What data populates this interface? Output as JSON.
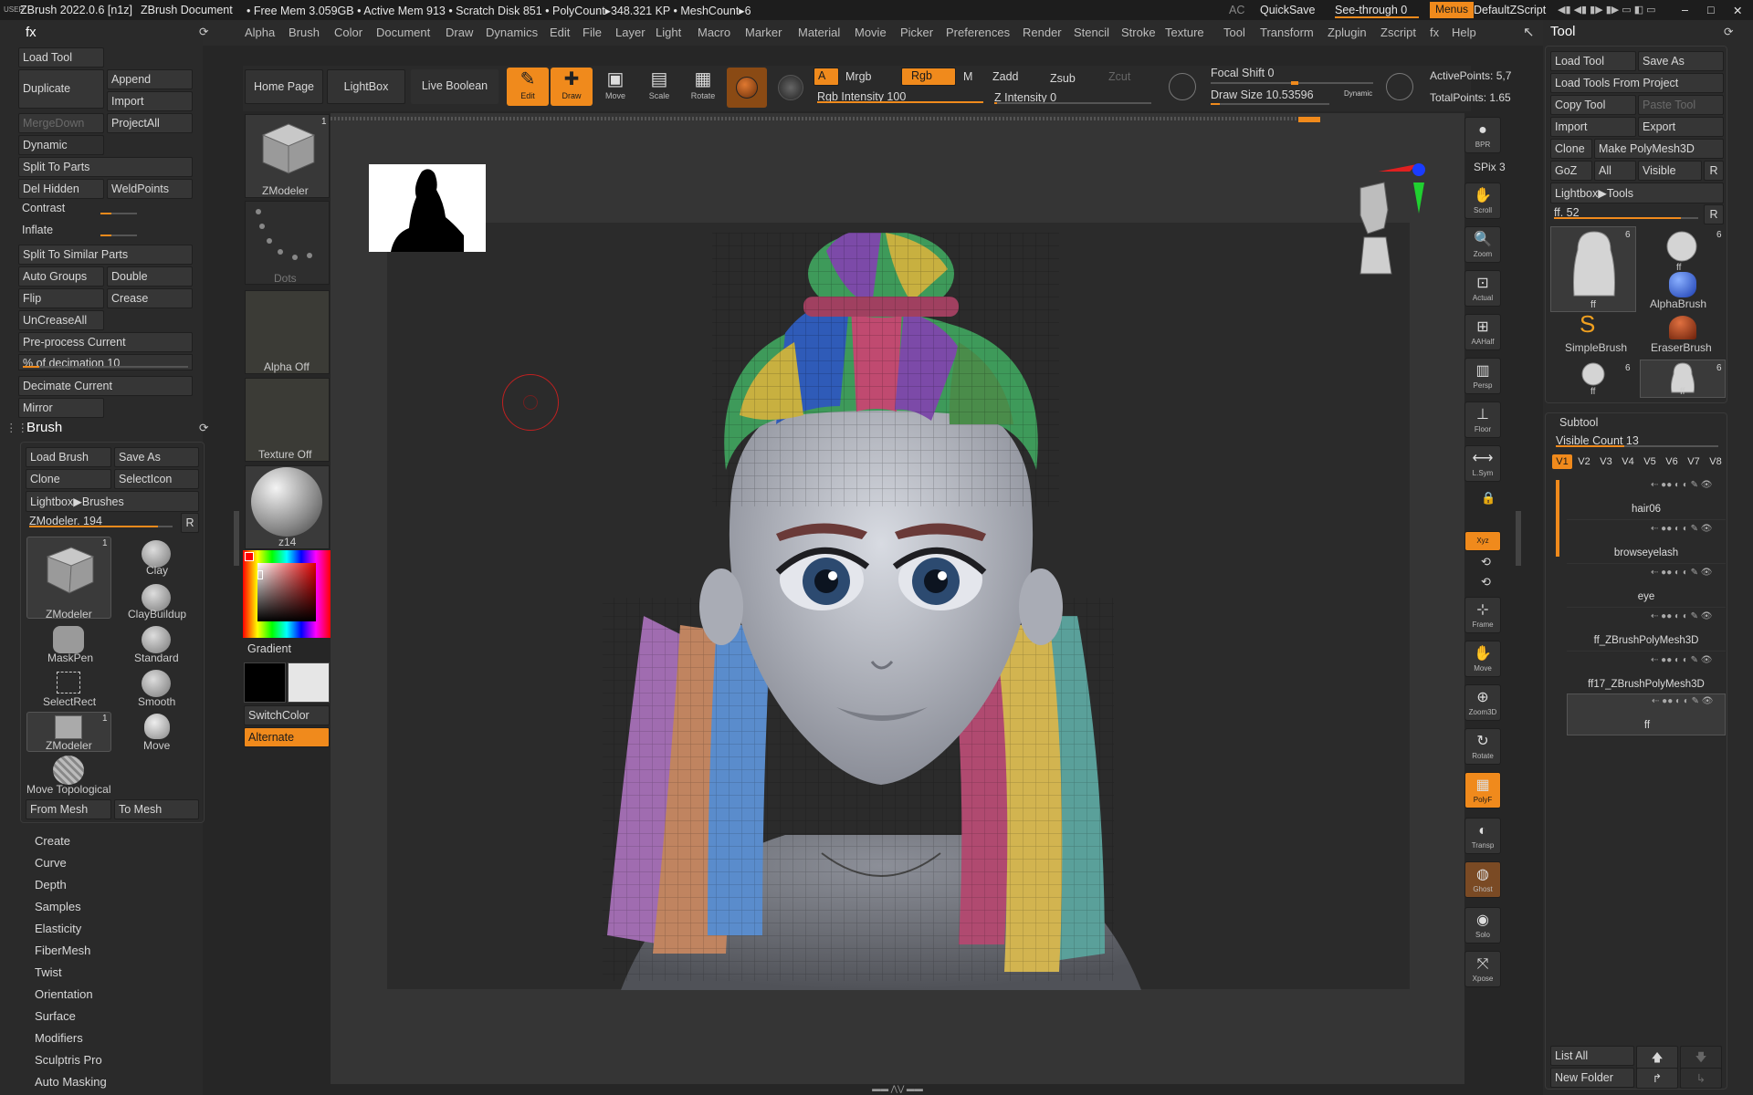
{
  "titlebar": {
    "app": "ZBrush 2022.0.6 [n1z]",
    "doc": "ZBrush Document",
    "stats": "• Free Mem 3.059GB • Active Mem 913 • Scratch Disk 851 • PolyCount▸348.321 KP • MeshCount▸6",
    "ac": "AC",
    "quicksave": "QuickSave",
    "seethrough": "See-through  0",
    "menus": "Menus",
    "script": "DefaultZScript",
    "min": "–",
    "max": "□",
    "close": "✕"
  },
  "menubar": [
    "Alpha",
    "Brush",
    "Color",
    "Document",
    "Draw",
    "Dynamics",
    "Edit",
    "File",
    "Layer",
    "Light",
    "Macro",
    "Marker",
    "Material",
    "Movie",
    "Picker",
    "Preferences",
    "Render",
    "Stencil",
    "Stroke",
    "Texture",
    "Tool",
    "Transform",
    "Zplugin",
    "Zscript",
    "fx",
    "Help"
  ],
  "toolbar": {
    "home": "Home Page",
    "lightbox": "LightBox",
    "liveboolean": "Live Boolean",
    "edit": "Edit",
    "draw": "Draw",
    "move": "Move",
    "scale": "Scale",
    "rotate": "Rotate",
    "a": "A",
    "mrgb": "Mrgb",
    "rgb": "Rgb",
    "m": "M",
    "zadd": "Zadd",
    "zsub": "Zsub",
    "zcut": "Zcut",
    "rgb_intensity": "Rgb Intensity 100",
    "z_intensity": "Z Intensity 0",
    "focal_shift": "Focal Shift 0",
    "draw_size": "Draw Size 10.53596",
    "dynamic": "Dynamic",
    "active_points": "ActivePoints: 5,7",
    "total_points": "TotalPoints: 1.65"
  },
  "left_fx": {
    "header": "fx",
    "load_tool": "Load Tool",
    "duplicate": "Duplicate",
    "append": "Append",
    "import": "Import",
    "mergedown": "MergeDown",
    "projectall": "ProjectAll",
    "dynamic": "Dynamic",
    "split_parts": "Split To Parts",
    "del_hidden": "Del Hidden",
    "weldpoints": "WeldPoints",
    "contrast": "Contrast",
    "inflate": "Inflate",
    "split_similar": "Split To Similar Parts",
    "auto_groups": "Auto Groups",
    "double": "Double",
    "flip": "Flip",
    "crease": "Crease",
    "uncreaseall": "UnCreaseAll",
    "preprocess": "Pre-process Current",
    "decimation": "% of decimation 10",
    "decimate_current": "Decimate Current",
    "mirror": "Mirror"
  },
  "brush_panel": {
    "header": "Brush",
    "load_brush": "Load Brush",
    "save_as": "Save As",
    "clone": "Clone",
    "selecticon": "SelectIcon",
    "lightbox_brushes": "Lightbox▶Brushes",
    "zmodeler_val": "ZModeler. 194",
    "r": "R",
    "brushes": [
      "ZModeler",
      "Clay",
      "ClayBuildup",
      "MaskPen",
      "Standard",
      "SelectRect",
      "Smooth",
      "ZModeler",
      "Move",
      "Move Topological"
    ],
    "from_mesh": "From Mesh",
    "to_mesh": "To Mesh"
  },
  "left_menu": [
    "Create",
    "Curve",
    "Depth",
    "Samples",
    "Elasticity",
    "FiberMesh",
    "Twist",
    "Orientation",
    "Surface",
    "Modifiers",
    "Sculptris Pro",
    "Auto Masking"
  ],
  "shelf": {
    "zmodeler": "ZModeler",
    "dots": "Dots",
    "alpha_off": "Alpha Off",
    "texture_off": "Texture Off",
    "material": "z14",
    "gradient": "Gradient",
    "switchcolor": "SwitchColor",
    "alternate": "Alternate",
    "count": "1"
  },
  "right_tools": [
    "BPR",
    "SPix 3",
    "Scroll",
    "Zoom",
    "Actual",
    "AAHalf",
    "Persp",
    "Floor",
    "L.Sym",
    "",
    "Xyz",
    "",
    "",
    "Frame",
    "Move",
    "Zoom3D",
    "Rotate",
    "PolyF",
    "Transp",
    "Ghost",
    "Solo",
    "Xpose"
  ],
  "tool_panel": {
    "header": "Tool",
    "load_tool": "Load Tool",
    "save_as": "Save As",
    "load_from_project": "Load Tools From Project",
    "copy_tool": "Copy Tool",
    "paste_tool": "Paste Tool",
    "import": "Import",
    "export": "Export",
    "clone": "Clone",
    "make_polymesh": "Make PolyMesh3D",
    "goz": "GoZ",
    "all": "All",
    "visible": "Visible",
    "r": "R",
    "lightbox_tools": "Lightbox▶Tools",
    "ff_val": "ff. 52",
    "thumbs": [
      "ff",
      "ff",
      "AlphaBrush",
      "SimpleBrush",
      "EraserBrush",
      "ff",
      "ff"
    ],
    "thumb_counts": [
      "6",
      "6",
      "6",
      "6"
    ],
    "subtool": "Subtool",
    "visible_count": "Visible Count 13",
    "versions": [
      "V1",
      "V2",
      "V3",
      "V4",
      "V5",
      "V6",
      "V7",
      "V8"
    ],
    "subtools": [
      "hair06",
      "browseyelash",
      "eye",
      "ff_ZBrushPolyMesh3D",
      "ff17_ZBrushPolyMesh3D",
      "ff"
    ],
    "list_all": "List All",
    "new_folder": "New Folder"
  },
  "colors": {
    "accent": "#f08a1c",
    "bg": "#262626",
    "panel": "#2a2a2a"
  }
}
